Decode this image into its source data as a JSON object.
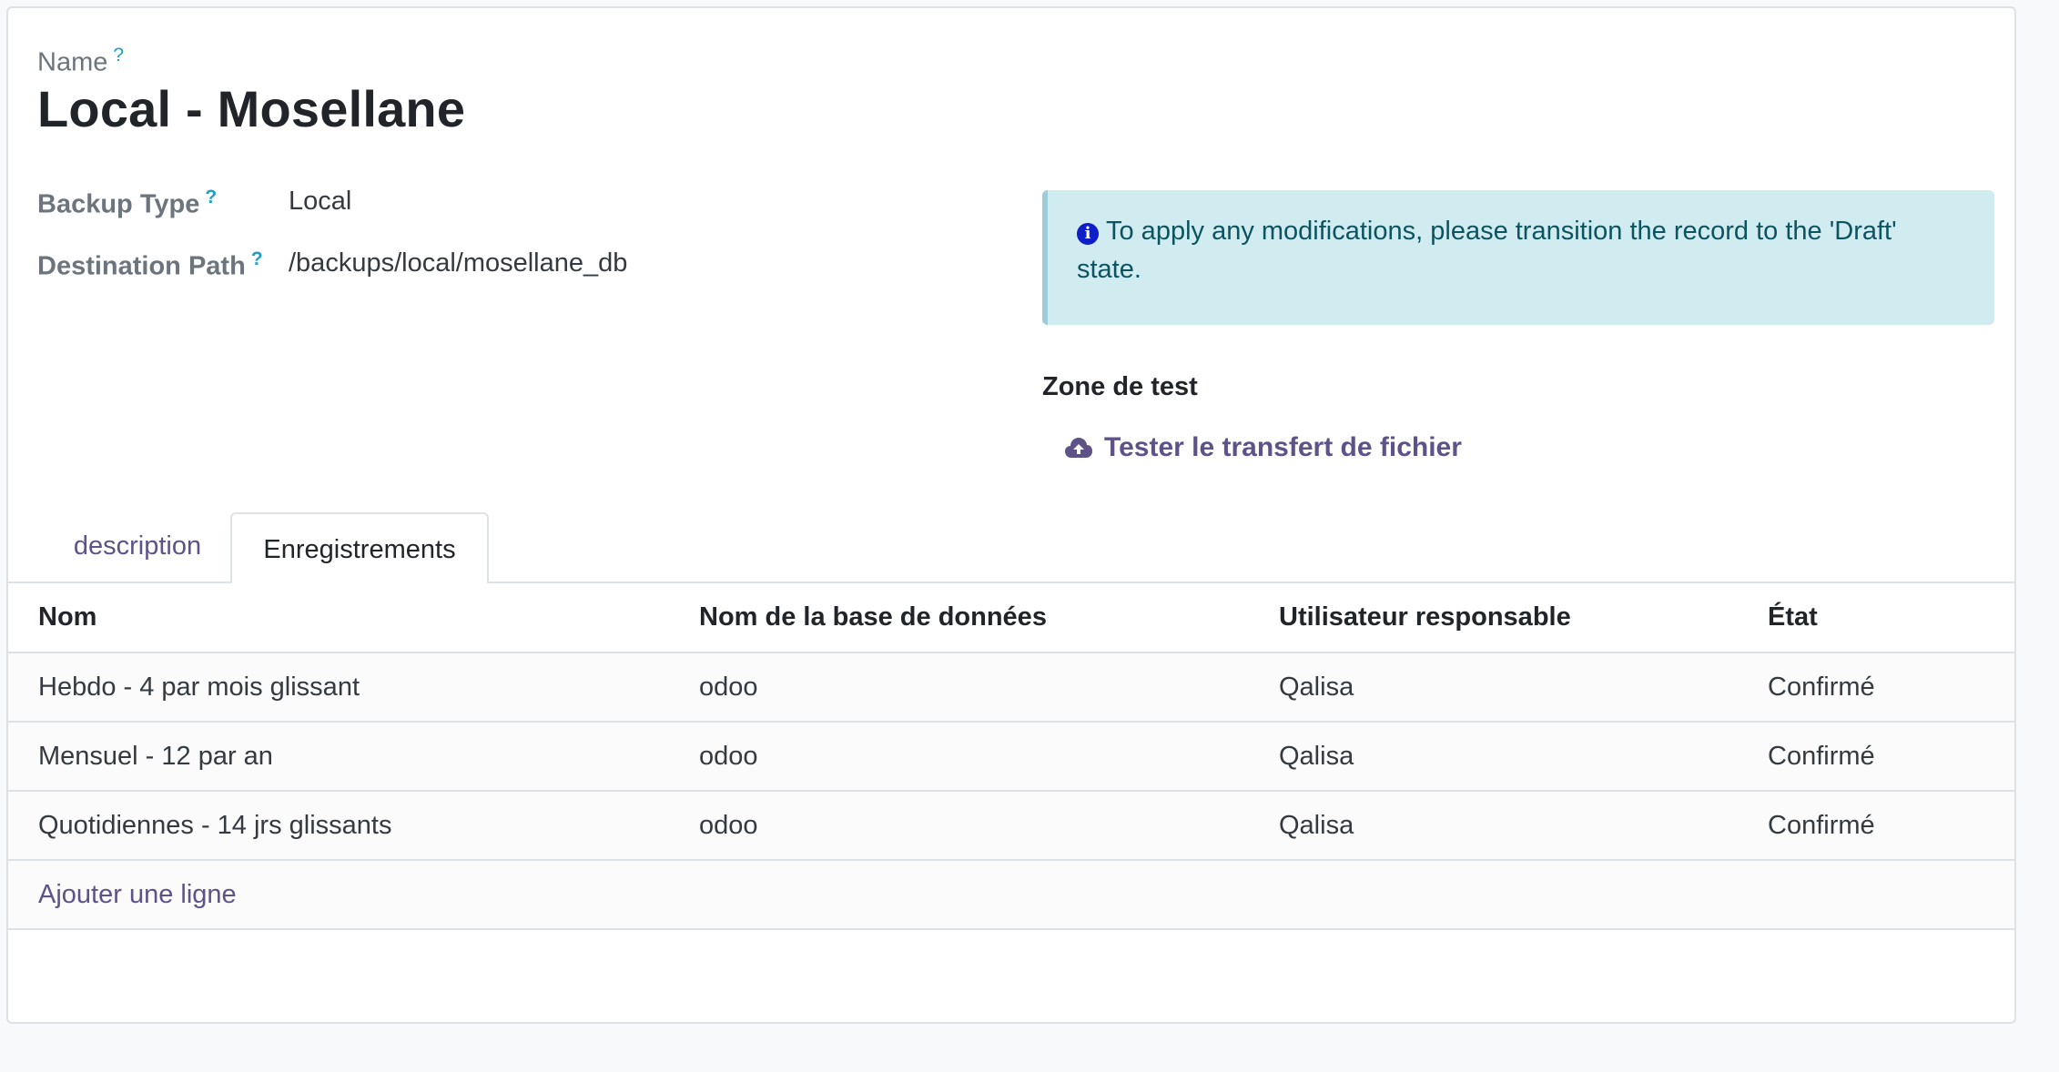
{
  "record": {
    "name_label": "Name",
    "help_mark": "?",
    "title": "Local - Mosellane"
  },
  "fields": [
    {
      "label": "Backup Type",
      "value": "Local"
    },
    {
      "label": "Destination Path",
      "value": "/backups/local/mosellane_db"
    }
  ],
  "alert": {
    "icon": "info-circle-icon",
    "text": "To apply any modifications, please transition the record to the 'Draft' state."
  },
  "test_zone": {
    "title": "Zone de test",
    "button_label": "Tester le transfert de fichier",
    "button_icon": "cloud-upload-icon"
  },
  "tabs": [
    {
      "label": "description",
      "active": false
    },
    {
      "label": "Enregistrements",
      "active": true
    }
  ],
  "table": {
    "headers": [
      "Nom",
      "Nom de la base de données",
      "Utilisateur responsable",
      "État"
    ],
    "rows": [
      [
        "Hebdo - 4 par mois glissant",
        "odoo",
        "Qalisa",
        "Confirmé"
      ],
      [
        "Mensuel - 12 par an",
        "odoo",
        "Qalisa",
        "Confirmé"
      ],
      [
        "Quotidiennes - 14 jrs glissants",
        "odoo",
        "Qalisa",
        "Confirmé"
      ]
    ],
    "add_line_label": "Ajouter une ligne"
  },
  "colors": {
    "accent": "#5e5288",
    "alert_bg": "#d1ecf1",
    "alert_text": "#0c5460",
    "help_mark": "#1f9fc4"
  }
}
